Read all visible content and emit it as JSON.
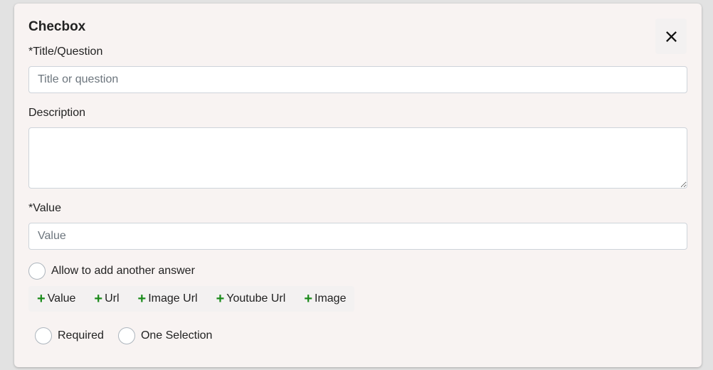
{
  "dialog": {
    "title": "Checbox",
    "close_icon": "close-icon"
  },
  "fields": {
    "title_label": "*Title/Question",
    "title_placeholder": "Title or question",
    "title_value": "",
    "description_label": "Description",
    "description_value": "",
    "value_label": "*Value",
    "value_placeholder": "Value",
    "value_value": ""
  },
  "options": {
    "allow_another": "Allow to add another answer",
    "required": "Required",
    "one_selection": "One Selection"
  },
  "add_buttons": [
    {
      "icon": "plus-icon",
      "label": "Value"
    },
    {
      "icon": "plus-icon",
      "label": "Url"
    },
    {
      "icon": "plus-icon",
      "label": "Image Url"
    },
    {
      "icon": "plus-icon",
      "label": "Youtube Url"
    },
    {
      "icon": "plus-icon",
      "label": "Image"
    }
  ],
  "colors": {
    "plus": "#1a8a1a",
    "card_bg": "#f8f3f2",
    "page_bg": "#e2e2e2"
  }
}
